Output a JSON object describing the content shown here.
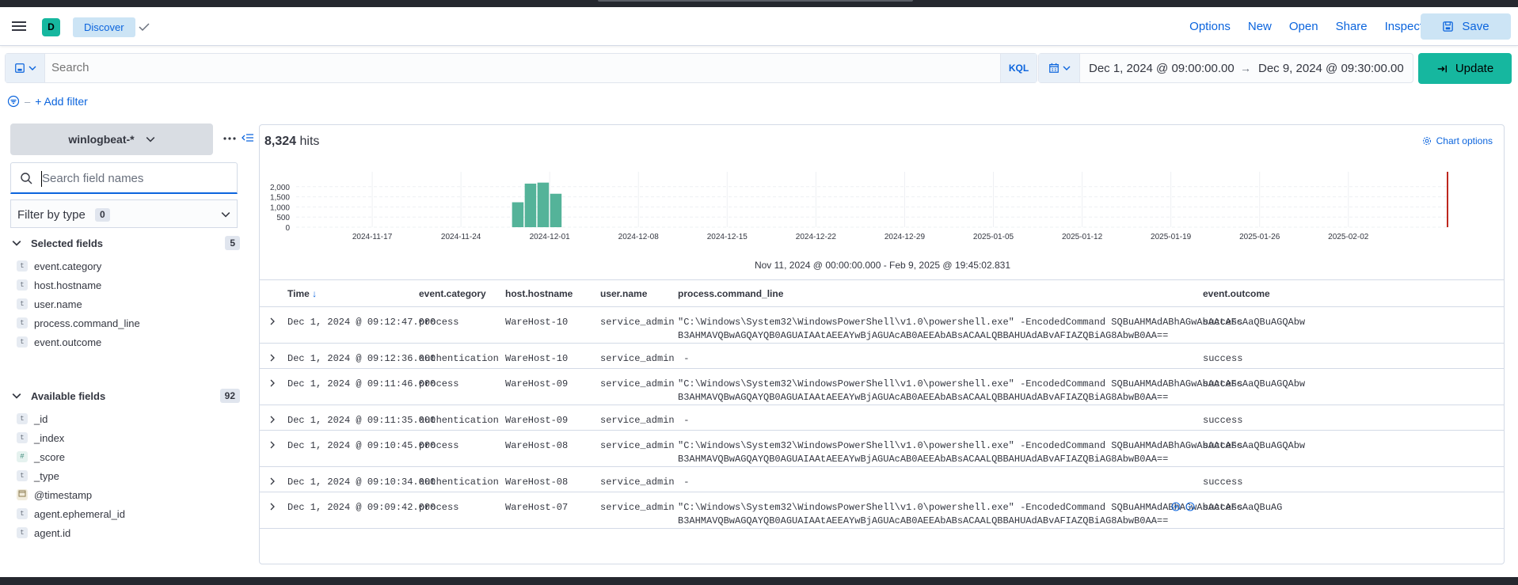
{
  "header": {
    "space_initial": "D",
    "breadcrumb": "Discover",
    "links": [
      "Options",
      "New",
      "Open",
      "Share",
      "Inspect"
    ],
    "save_label": "Save"
  },
  "query": {
    "placeholder": "Search",
    "language": "KQL",
    "date_start": "Dec 1, 2024 @ 09:00:00.00",
    "date_end": "Dec 9, 2024 @ 09:30:00.00",
    "update_label": "Update",
    "add_filter": "+ Add filter"
  },
  "sidebar": {
    "index_pattern": "winlogbeat-*",
    "field_search_placeholder": "Search field names",
    "filter_by_type": "Filter by type",
    "filter_count": "0",
    "selected_title": "Selected fields",
    "selected_count": "5",
    "selected_fields": [
      {
        "type": "t",
        "name": "event.category"
      },
      {
        "type": "t",
        "name": "host.hostname"
      },
      {
        "type": "t",
        "name": "user.name"
      },
      {
        "type": "t",
        "name": "process.command_line"
      },
      {
        "type": "t",
        "name": "event.outcome"
      }
    ],
    "available_title": "Available fields",
    "available_count": "92",
    "available_fields": [
      {
        "type": "t",
        "name": "_id"
      },
      {
        "type": "t",
        "name": "_index"
      },
      {
        "type": "#",
        "name": "_score"
      },
      {
        "type": "t",
        "name": "_type"
      },
      {
        "type": "date",
        "name": "@timestamp"
      },
      {
        "type": "t",
        "name": "agent.ephemeral_id"
      },
      {
        "type": "t",
        "name": "agent.id"
      }
    ]
  },
  "main": {
    "hits_count": "8,324",
    "hits_label": "hits",
    "chart_options": "Chart options",
    "time_range": "Nov 11, 2024 @ 00:00:00.000 - Feb 9, 2025 @ 19:45:02.831"
  },
  "chart_data": {
    "type": "bar",
    "y_ticks": [
      "2,000",
      "1,500",
      "1,000",
      "500",
      "0"
    ],
    "ylim": [
      0,
      2500
    ],
    "x_ticks": [
      "2024-11-17",
      "2024-11-24",
      "2024-12-01",
      "2024-12-08",
      "2024-12-15",
      "2024-12-22",
      "2024-12-29",
      "2025-01-05",
      "2025-01-12",
      "2025-01-19",
      "2025-01-26",
      "2025-02-02"
    ],
    "categories": [
      "2024-11-28",
      "2024-11-29",
      "2024-11-30",
      "2024-12-01"
    ],
    "values": [
      1230,
      2150,
      2200,
      1650
    ],
    "bar_color": "#54b399",
    "marker_color": "#bd271e"
  },
  "table": {
    "columns": [
      "Time",
      "event.category",
      "host.hostname",
      "user.name",
      "process.command_line",
      "event.outcome"
    ],
    "rows": [
      {
        "time": "Dec 1, 2024 @ 09:12:47.000",
        "category": "process",
        "host": "WareHost-10",
        "user": "service_admin",
        "cmd": "\"C:\\Windows\\System32\\WindowsPowerShell\\v1.0\\powershell.exe\" -EncodedCommand SQBuAHMAdABhAGwAbAAtAFcAaQBuAGQAbw\nB3AHMAVQBwAGQAYQB0AGUAIAAtAEEAYwBjAGUAcAB0AEEAbABsACAALQBBAHUAdABvAFIAZQBiAG8AbwB0AA==",
        "outcome": "success"
      },
      {
        "time": "Dec 1, 2024 @ 09:12:36.000",
        "category": "authentication",
        "host": "WareHost-10",
        "user": "service_admin",
        "cmd": " -",
        "outcome": "success"
      },
      {
        "time": "Dec 1, 2024 @ 09:11:46.000",
        "category": "process",
        "host": "WareHost-09",
        "user": "service_admin",
        "cmd": "\"C:\\Windows\\System32\\WindowsPowerShell\\v1.0\\powershell.exe\" -EncodedCommand SQBuAHMAdABhAGwAbAAtAFcAaQBuAGQAbw\nB3AHMAVQBwAGQAYQB0AGUAIAAtAEEAYwBjAGUAcAB0AEEAbABsACAALQBBAHUAdABvAFIAZQBiAG8AbwB0AA==",
        "outcome": "success"
      },
      {
        "time": "Dec 1, 2024 @ 09:11:35.000",
        "category": "authentication",
        "host": "WareHost-09",
        "user": "service_admin",
        "cmd": " -",
        "outcome": "success"
      },
      {
        "time": "Dec 1, 2024 @ 09:10:45.000",
        "category": "process",
        "host": "WareHost-08",
        "user": "service_admin",
        "cmd": "\"C:\\Windows\\System32\\WindowsPowerShell\\v1.0\\powershell.exe\" -EncodedCommand SQBuAHMAdABhAGwAbAAtAFcAaQBuAGQAbw\nB3AHMAVQBwAGQAYQB0AGUAIAAtAEEAYwBjAGUAcAB0AEEAbABsACAALQBBAHUAdABvAFIAZQBiAG8AbwB0AA==",
        "outcome": "success"
      },
      {
        "time": "Dec 1, 2024 @ 09:10:34.000",
        "category": "authentication",
        "host": "WareHost-08",
        "user": "service_admin",
        "cmd": " -",
        "outcome": "success"
      },
      {
        "time": "Dec 1, 2024 @ 09:09:42.000",
        "category": "process",
        "host": "WareHost-07",
        "user": "service_admin",
        "cmd": "\"C:\\Windows\\System32\\WindowsPowerShell\\v1.0\\powershell.exe\" -EncodedCommand SQBuAHMAdABhAGwAbAAtAFcAaQBuAG\nB3AHMAVQBwAGQAYQB0AGUAIAAtAEEAYwBjAGUAcAB0AEEAbABsACAALQBBAHUAdABvAFIAZQBiAG8AbwB0AA==",
        "outcome": "success"
      }
    ]
  }
}
